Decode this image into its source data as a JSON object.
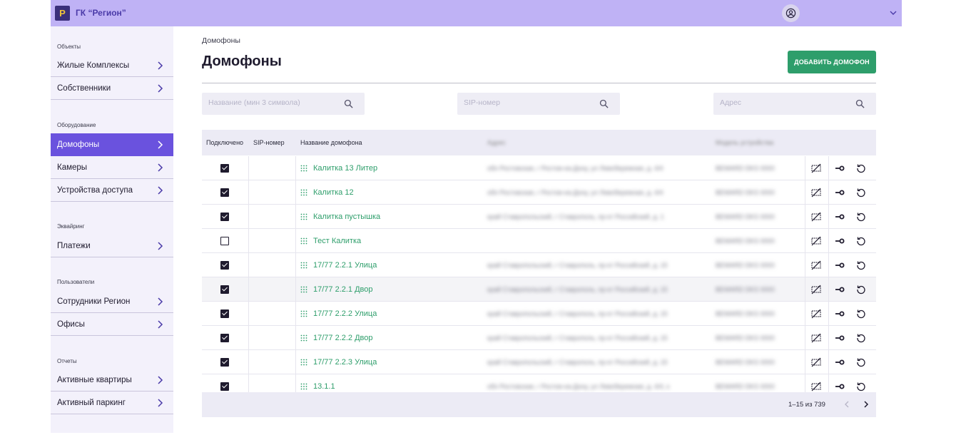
{
  "header": {
    "logo_letter": "P",
    "company": "ГК “Регион”",
    "colors": {
      "topbar": "#bfb2f5",
      "accent": "#6a52de",
      "brand_green": "#2e9e6b"
    }
  },
  "sidebar": {
    "sections": [
      {
        "title": "Объекты",
        "items": [
          "Жилые Комплексы",
          "Собственники"
        ]
      },
      {
        "title": "Оборудование",
        "items": [
          "Домофоны",
          "Камеры",
          "Устройства доступа"
        ]
      },
      {
        "title": "Эквайринг",
        "items": [
          "Платежи"
        ]
      },
      {
        "title": "Пользователи",
        "items": [
          "Сотрудники Регион",
          "Офисы"
        ]
      },
      {
        "title": "Отчеты",
        "items": [
          "Активные квартиры",
          "Активный паркинг"
        ]
      }
    ],
    "active_item": "Домофоны"
  },
  "main": {
    "breadcrumb": "Домофоны",
    "title": "Домофоны",
    "add_button": "ДОБАВИТЬ ДОМОФОН",
    "search": {
      "name_placeholder": "Название (мин 3 символа)",
      "sip_placeholder": "SIP-номер",
      "address_placeholder": "Адрес"
    }
  },
  "table": {
    "columns": {
      "connected": "Подключено",
      "sip": "SIP-номер",
      "name": "Название домофона",
      "address": "Адрес",
      "model": "Модель устройства"
    },
    "rows": [
      {
        "connected": true,
        "name": "Калитка 13 Литер",
        "address": "обл Ростовская, г Ростов-на-Дону, ул Левобережная, д. 4/4",
        "model": "BEWARD DKS 0000"
      },
      {
        "connected": true,
        "name": "Калитка 12",
        "address": "обл Ростовская, г Ростов-на-Дону, ул Левобережная, д. 4/4",
        "model": "BEWARD DKS 0000"
      },
      {
        "connected": true,
        "name": "Калитка пустышка",
        "address": "край Ставропольский, г Ставрополь, пр-кт Российский, д. 1",
        "model": "BEWARD DKS 0000"
      },
      {
        "connected": false,
        "name": "Тест Калитка",
        "address": "",
        "model": "BEWARD DKS 0000"
      },
      {
        "connected": true,
        "name": "17/77 2.2.1 Улица",
        "address": "край Ставропольский, г Ставрополь, пр-кт Российский, д. 15",
        "model": "BEWARD DKS 0000"
      },
      {
        "connected": true,
        "name": "17/77 2.2.1 Двор",
        "address": "край Ставропольский, г Ставрополь, пр-кт Российский, д. 15",
        "model": "BEWARD DKS 0000"
      },
      {
        "connected": true,
        "name": "17/77 2.2.2 Улица",
        "address": "край Ставропольский, г Ставрополь, пр-кт Российский, д. 15",
        "model": "BEWARD DKS 0000"
      },
      {
        "connected": true,
        "name": "17/77 2.2.2 Двор",
        "address": "край Ставропольский, г Ставрополь, пр-кт Российский, д. 15",
        "model": "BEWARD DKS 0000"
      },
      {
        "connected": true,
        "name": "17/77 2.2.3 Улица",
        "address": "край Ставропольский, г Ставрополь, пр-кт Российский, д. 15",
        "model": "BEWARD DKS 0000"
      },
      {
        "connected": true,
        "name": "13.1.1",
        "address": "обл Ростовская, г Ростов-на-Дону, ул Левобережная, д. 4/4, к",
        "model": "BEWARD DKS 0000"
      }
    ],
    "row_actions": [
      "no-video-icon",
      "key-icon",
      "restart-icon"
    ]
  },
  "pagination": {
    "range_text": "1–15 из 739"
  }
}
